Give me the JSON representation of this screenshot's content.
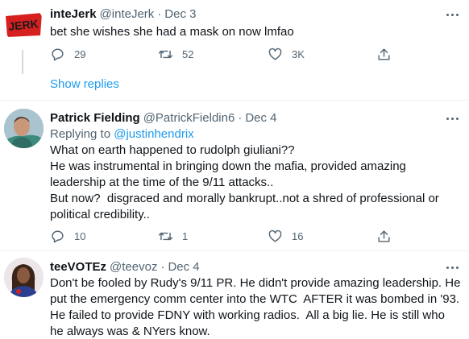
{
  "tweets": [
    {
      "name": "inteJerk",
      "handle": "@inteJerk",
      "sep": "·",
      "date": "Dec 3",
      "avatar_text": "JERK",
      "text": "bet she wishes she had a mask on now lmfao",
      "replies": "29",
      "retweets": "52",
      "likes": "3K",
      "show_replies": "Show replies"
    },
    {
      "name": "Patrick Fielding",
      "handle": "@PatrickFieldin6",
      "sep": "·",
      "date": "Dec 4",
      "replying_label": "Replying to ",
      "replying_handle": "@justinhendrix",
      "text": "What on earth happened to rudolph giuliani??\nHe was instrumental in bringing down the mafia, provided amazing\nleadership at the time of the 9/11 attacks..\nBut now?  disgraced and morally bankrupt..not a shred of professional or\npolitical credibility..",
      "replies": "10",
      "retweets": "1",
      "likes": "16"
    },
    {
      "name": "teeVOTEz",
      "handle": "@teevoz",
      "sep": "·",
      "date": "Dec 4",
      "text": "Don't be fooled by Rudy's 9/11 PR. He didn't provide amazing leadership. He\nput the emergency comm center into the WTC  AFTER it was bombed in '93.\nHe failed to provide FDNY with working radios.  All a big lie. He is still who\nhe always was & NYers know."
    }
  ],
  "icons": {
    "reply": "reply-icon",
    "retweet": "retweet-icon",
    "like": "heart-icon",
    "share": "share-icon",
    "more": "more-icon"
  },
  "colors": {
    "link": "#1d9bf0",
    "secondary": "#536471",
    "text": "#0f1419",
    "logo_red": "#d62020"
  }
}
